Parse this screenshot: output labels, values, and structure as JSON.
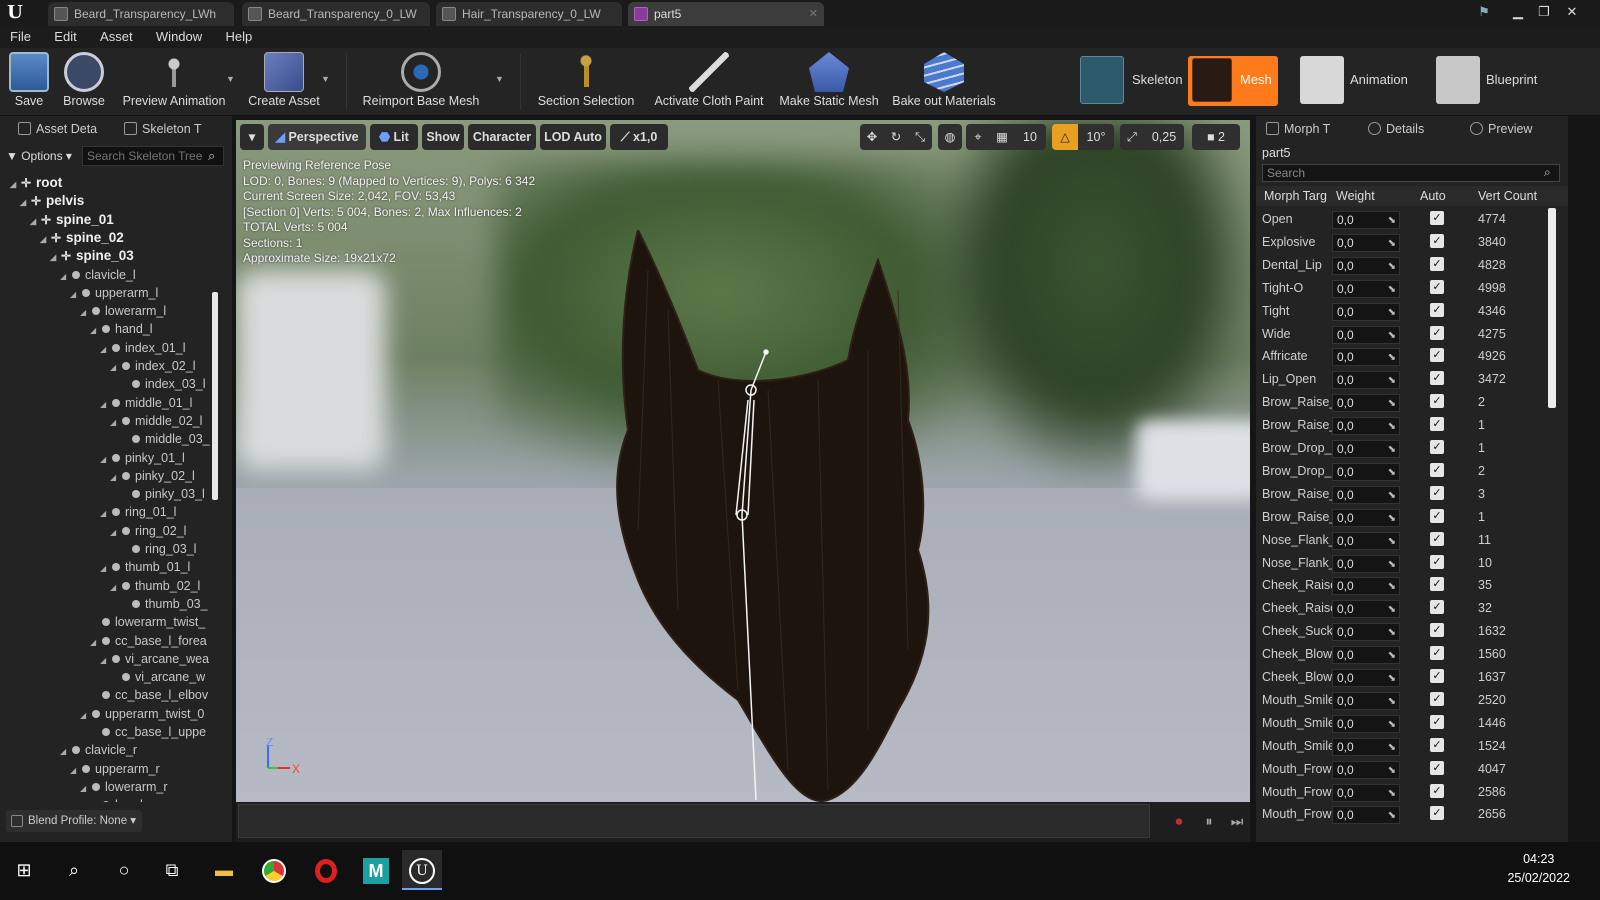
{
  "tabs": [
    "Beard_Transparency_LWh",
    "Beard_Transparency_0_LW",
    "Hair_Transparency_0_LW",
    "part5"
  ],
  "menu": [
    "File",
    "Edit",
    "Asset",
    "Window",
    "Help"
  ],
  "toolbar": {
    "save": "Save",
    "browse": "Browse",
    "preview_animation": "Preview Animation",
    "create_asset": "Create Asset",
    "reimport": "Reimport Base Mesh",
    "section_selection": "Section Selection",
    "activate_cloth": "Activate Cloth Paint",
    "make_static": "Make Static Mesh",
    "bake_materials": "Bake out Materials",
    "modes": {
      "skeleton": "Skeleton",
      "mesh": "Mesh",
      "animation": "Animation",
      "blueprint": "Blueprint"
    }
  },
  "left_panel": {
    "tab1": "Asset Deta",
    "tab2": "Skeleton T",
    "options": "Options",
    "search_placeholder": "Search Skeleton Tree",
    "blend_profile": "Blend Profile: None",
    "tree": [
      {
        "label": "root",
        "depth": 0,
        "bold": true
      },
      {
        "label": "pelvis",
        "depth": 1,
        "bold": true
      },
      {
        "label": "spine_01",
        "depth": 2,
        "bold": true
      },
      {
        "label": "spine_02",
        "depth": 3,
        "bold": true
      },
      {
        "label": "spine_03",
        "depth": 4,
        "bold": true
      },
      {
        "label": "clavicle_l",
        "depth": 5
      },
      {
        "label": "upperarm_l",
        "depth": 6
      },
      {
        "label": "lowerarm_l",
        "depth": 7
      },
      {
        "label": "hand_l",
        "depth": 8
      },
      {
        "label": "index_01_l",
        "depth": 9
      },
      {
        "label": "index_02_l",
        "depth": 10
      },
      {
        "label": "index_03_l",
        "depth": 11
      },
      {
        "label": "middle_01_l",
        "depth": 9
      },
      {
        "label": "middle_02_l",
        "depth": 10
      },
      {
        "label": "middle_03_",
        "depth": 11
      },
      {
        "label": "pinky_01_l",
        "depth": 9
      },
      {
        "label": "pinky_02_l",
        "depth": 10
      },
      {
        "label": "pinky_03_l",
        "depth": 11
      },
      {
        "label": "ring_01_l",
        "depth": 9
      },
      {
        "label": "ring_02_l",
        "depth": 10
      },
      {
        "label": "ring_03_l",
        "depth": 11
      },
      {
        "label": "thumb_01_l",
        "depth": 9
      },
      {
        "label": "thumb_02_l",
        "depth": 10
      },
      {
        "label": "thumb_03_",
        "depth": 11
      },
      {
        "label": "lowerarm_twist_",
        "depth": 8
      },
      {
        "label": "cc_base_l_forea",
        "depth": 8
      },
      {
        "label": "vi_arcane_wea",
        "depth": 9
      },
      {
        "label": "vi_arcane_w",
        "depth": 10
      },
      {
        "label": "cc_base_l_elbov",
        "depth": 8
      },
      {
        "label": "upperarm_twist_0",
        "depth": 7
      },
      {
        "label": "cc_base_l_uppe",
        "depth": 8
      },
      {
        "label": "clavicle_r",
        "depth": 5
      },
      {
        "label": "upperarm_r",
        "depth": 6
      },
      {
        "label": "lowerarm_r",
        "depth": 7
      },
      {
        "label": "hand_r",
        "depth": 8
      }
    ]
  },
  "viewport": {
    "perspective": "Perspective",
    "lit": "Lit",
    "show": "Show",
    "character": "Character",
    "lod": "LOD Auto",
    "speed": "x1,0",
    "grid": "10",
    "angle": "10°",
    "scale": "0,25",
    "camera_speed": "2",
    "info": [
      "Previewing Reference Pose",
      "LOD: 0, Bones: 9 (Mapped to Vertices: 9), Polys: 6 342",
      "Current Screen Size: 2,042, FOV: 53,43",
      "[Section 0] Verts: 5 004, Bones: 2, Max Influences: 2",
      "TOTAL Verts: 5 004",
      "Sections: 1",
      "Approximate Size: 19x21x72"
    ],
    "axis_z": "Z",
    "axis_x": "X"
  },
  "right_panel": {
    "tab1": "Morph T",
    "tab2": "Details",
    "tab3": "Preview",
    "asset": "part5",
    "search_placeholder": "Search",
    "columns": [
      "Morph Targ",
      "Weight",
      "Auto",
      "Vert Count"
    ],
    "rows": [
      {
        "name": "Open",
        "weight": "0,0",
        "verts": "4774"
      },
      {
        "name": "Explosive",
        "weight": "0,0",
        "verts": "3840"
      },
      {
        "name": "Dental_Lip",
        "weight": "0,0",
        "verts": "4828"
      },
      {
        "name": "Tight-O",
        "weight": "0,0",
        "verts": "4998"
      },
      {
        "name": "Tight",
        "weight": "0,0",
        "verts": "4346"
      },
      {
        "name": "Wide",
        "weight": "0,0",
        "verts": "4275"
      },
      {
        "name": "Affricate",
        "weight": "0,0",
        "verts": "4926"
      },
      {
        "name": "Lip_Open",
        "weight": "0,0",
        "verts": "3472"
      },
      {
        "name": "Brow_Raise_",
        "weight": "0,0",
        "verts": "2"
      },
      {
        "name": "Brow_Raise_",
        "weight": "0,0",
        "verts": "1"
      },
      {
        "name": "Brow_Drop_L",
        "weight": "0,0",
        "verts": "1"
      },
      {
        "name": "Brow_Drop_R",
        "weight": "0,0",
        "verts": "2"
      },
      {
        "name": "Brow_Raise_",
        "weight": "0,0",
        "verts": "3"
      },
      {
        "name": "Brow_Raise_",
        "weight": "0,0",
        "verts": "1"
      },
      {
        "name": "Nose_Flank_",
        "weight": "0,0",
        "verts": "11"
      },
      {
        "name": "Nose_Flank_",
        "weight": "0,0",
        "verts": "10"
      },
      {
        "name": "Cheek_Raise",
        "weight": "0,0",
        "verts": "35"
      },
      {
        "name": "Cheek_Raise",
        "weight": "0,0",
        "verts": "32"
      },
      {
        "name": "Cheek_Suck",
        "weight": "0,0",
        "verts": "1632"
      },
      {
        "name": "Cheek_Blow",
        "weight": "0,0",
        "verts": "1560"
      },
      {
        "name": "Cheek_Blow",
        "weight": "0,0",
        "verts": "1637"
      },
      {
        "name": "Mouth_Smile",
        "weight": "0,0",
        "verts": "2520"
      },
      {
        "name": "Mouth_Smile",
        "weight": "0,0",
        "verts": "1446"
      },
      {
        "name": "Mouth_Smile",
        "weight": "0,0",
        "verts": "1524"
      },
      {
        "name": "Mouth_Frow",
        "weight": "0,0",
        "verts": "4047"
      },
      {
        "name": "Mouth_Frow",
        "weight": "0,0",
        "verts": "2586"
      },
      {
        "name": "Mouth_Frow",
        "weight": "0,0",
        "verts": "2656"
      }
    ]
  },
  "taskbar": {
    "time": "04:23",
    "date": "25/02/2022"
  },
  "colors": {
    "accent": "#e8a020",
    "mesh_active": "#ff7a1a",
    "background": "#151515"
  }
}
